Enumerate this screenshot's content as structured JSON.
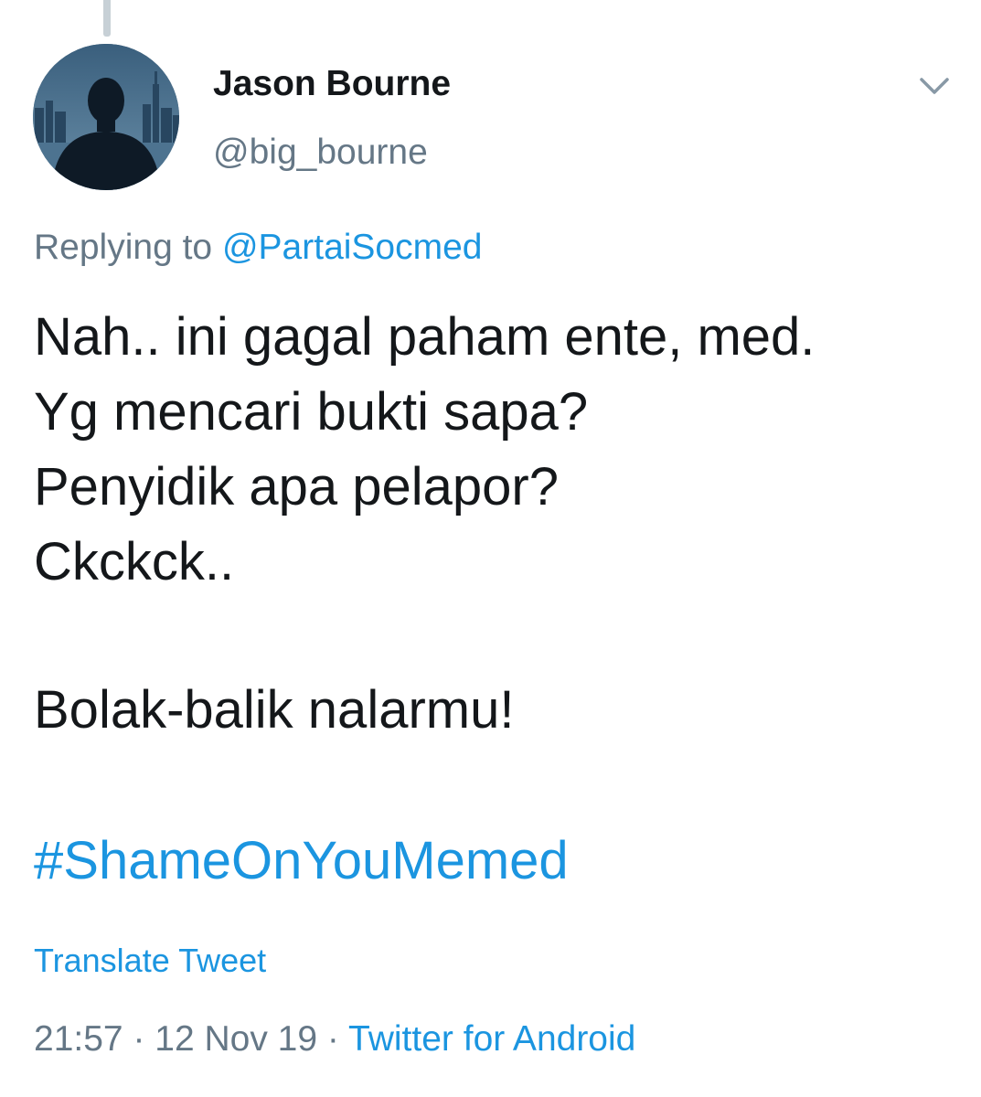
{
  "author": {
    "display_name": "Jason Bourne",
    "handle": "@big_bourne",
    "avatar_icon": "avatar-man-city-skyline"
  },
  "reply": {
    "prefix": "Replying to ",
    "mention": "@PartaiSocmed"
  },
  "tweet": {
    "lines": [
      "Nah.. ini gagal paham ente, med.",
      "Yg mencari bukti sapa?",
      "Penyidik apa pelapor?",
      "Ckckck..",
      "Bolak-balik nalarmu!"
    ],
    "hashtag": "#ShameOnYouMemed"
  },
  "translate_label": "Translate Tweet",
  "meta": {
    "time": "21:57",
    "separator": " · ",
    "date": "12 Nov 19",
    "source": "Twitter for Android"
  },
  "icons": {
    "caret": "chevron-down-icon"
  },
  "colors": {
    "link": "#1b95e0",
    "secondary_text": "#657786",
    "primary_text": "#14171a",
    "thread_line": "#c7d0d6"
  }
}
